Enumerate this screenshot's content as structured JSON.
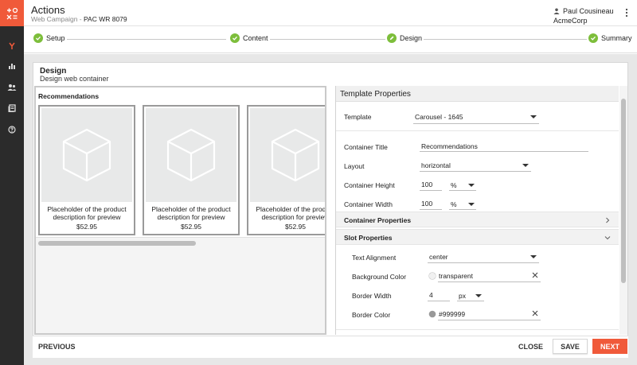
{
  "app": {
    "title": "Actions",
    "subtitle_prefix": "Web Campaign - ",
    "campaign_name": "PAC WR 8079",
    "user_name": "Paul Cousineau",
    "org_name": "AcmeCorp"
  },
  "rail": {
    "accent_color": "#f05a3a",
    "items": [
      {
        "icon": "fork-icon",
        "active": true
      },
      {
        "icon": "bar-chart-icon",
        "active": false
      },
      {
        "icon": "people-icon",
        "active": false
      },
      {
        "icon": "book-icon",
        "active": false
      },
      {
        "icon": "help-circle-icon",
        "active": false
      }
    ]
  },
  "stepper": {
    "steps": [
      {
        "label": "Setup",
        "state": "complete"
      },
      {
        "label": "Content",
        "state": "complete"
      },
      {
        "label": "Design",
        "state": "editing"
      },
      {
        "label": "Summary",
        "state": "complete"
      }
    ],
    "done_color": "#7dbe3b"
  },
  "design": {
    "title": "Design",
    "subtitle": "Design web container"
  },
  "preview": {
    "title": "Recommendations",
    "products": [
      {
        "description": "Placeholder of the product description for preview",
        "price": "$52.95"
      },
      {
        "description": "Placeholder of the product description for preview",
        "price": "$52.95"
      },
      {
        "description": "Placeholder of the product description for preview",
        "price": "$52.95"
      }
    ]
  },
  "properties": {
    "header": "Template Properties",
    "template_label": "Template",
    "template_value": "Carousel - 1645",
    "container_title_label": "Container Title",
    "container_title_value": "Recommendations",
    "layout_label": "Layout",
    "layout_value": "horizontal",
    "container_height_label": "Container Height",
    "container_height_value": "100",
    "container_height_unit": "%",
    "container_width_label": "Container Width",
    "container_width_value": "100",
    "container_width_unit": "%",
    "container_properties_label": "Container Properties",
    "slot_properties_label": "Slot Properties",
    "text_alignment_label": "Text Alignment",
    "text_alignment_value": "center",
    "background_color_label": "Background Color",
    "background_color_value": "transparent",
    "border_width_label": "Border Width",
    "border_width_value": "4",
    "border_width_unit": "px",
    "border_color_label": "Border Color",
    "border_color_value": "#999999"
  },
  "footer": {
    "previous_label": "PREVIOUS",
    "close_label": "CLOSE",
    "save_label": "SAVE",
    "next_label": "NEXT"
  }
}
